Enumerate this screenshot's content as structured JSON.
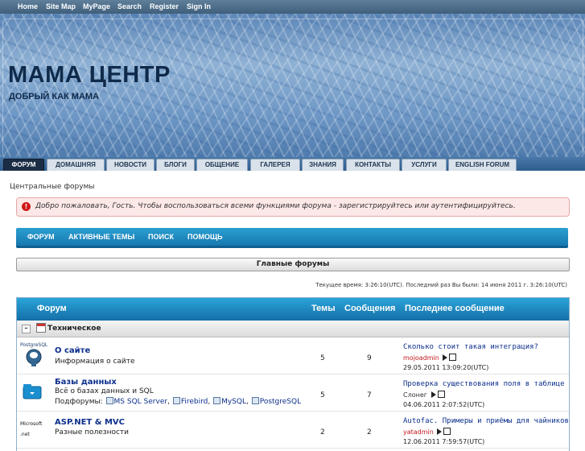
{
  "topnav": [
    "Home",
    "Site Map",
    "MyPage",
    "Search",
    "Register",
    "Sign In"
  ],
  "header": {
    "title": "МАМА ЦЕНТР",
    "subtitle": "ДОБРЫЙ КАК МАМА"
  },
  "tabs": [
    "ФОРУМ",
    "ДОМАШНЯЯ",
    "НОВОСТИ",
    "БЛОГИ",
    "ОБЩЕНИЕ",
    "ГАЛЕРЕЯ",
    "ЗНАНИЯ",
    "КОНТАКТЫ",
    "УСЛУГИ",
    "ENGLISH FORUM"
  ],
  "breadcrumb": "Центральные форумы",
  "welcome": {
    "icon": "!",
    "text": "Добро пожаловать, Гость. Чтобы воспользоваться всеми функциями форума - зарегистрируйтесь или аутентифицируйтесь."
  },
  "menu": [
    "ФОРУМ",
    "АКТИВНЫЕ ТЕМЫ",
    "ПОИСК",
    "ПОМОЩЬ"
  ],
  "main_forums_label": "Главные форумы",
  "time_info": "Текущее время: 3:26:10(UTC). Последний раз Вы были: 14 июня 2011 г. 3:26:10(UTC)",
  "table": {
    "headers": {
      "forum": "Форум",
      "topics": "Темы",
      "posts": "Сообщения",
      "last_post": "Последнее сообщение"
    },
    "category": {
      "collapse": "–",
      "title": "Техническое"
    },
    "forums": [
      {
        "icon_label": "PostgreSQL",
        "name": "О сайте",
        "description": "Информация о сайте",
        "subforums_label": "",
        "subforums": [],
        "topics": "5",
        "posts": "9",
        "last_title": "Сколько стоит такая интеграция?",
        "last_user": "mojoadmin",
        "last_user_color": "#c0161c",
        "last_date": "29.05.2011 13:09:20(UTC)"
      },
      {
        "icon_label": "",
        "name": "Базы данных",
        "description": "Всё о базах данных и SQL",
        "subforums_label": "Подфорумы:",
        "subforums": [
          "MS SQL Server",
          "Firebird",
          "MySQL",
          "PostgreSQL"
        ],
        "topics": "5",
        "posts": "7",
        "last_title": "Проверка существования поля в таблице",
        "last_user": "Слонег",
        "last_user_color": "#333333",
        "last_date": "04.06.2011 2:07:52(UTC)"
      },
      {
        "icon_label": "Microsoft .net",
        "name": "ASP.NET & MVC",
        "description": "Разные полезности",
        "subforums_label": "",
        "subforums": [],
        "topics": "2",
        "posts": "2",
        "last_title": "Autofac. Примеры и приёмы для чайников",
        "last_user": "yatadmin",
        "last_user_color": "#c0161c",
        "last_date": "12.06.2011 7:59:57(UTC)"
      }
    ]
  },
  "colors": {
    "accent": "#1778b0",
    "link": "#0c2f8c",
    "alert_bg": "#fde8e8"
  }
}
